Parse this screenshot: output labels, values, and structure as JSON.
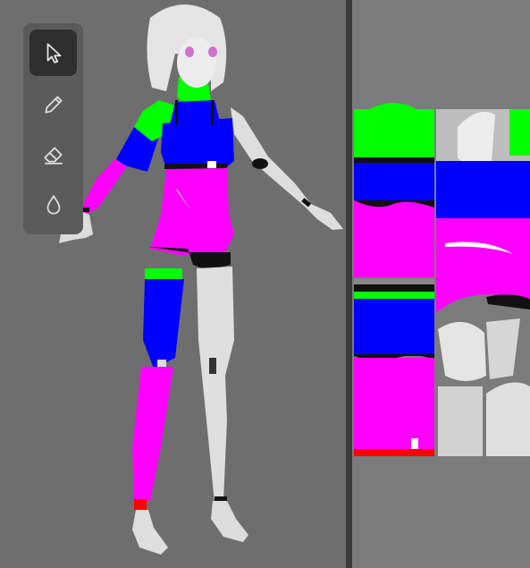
{
  "toolbar": {
    "tools": [
      {
        "name": "select",
        "icon": "cursor-arrow-icon",
        "active": true
      },
      {
        "name": "paint",
        "icon": "pencil-icon",
        "active": false
      },
      {
        "name": "erase",
        "icon": "eraser-icon",
        "active": false
      },
      {
        "name": "fill",
        "icon": "droplet-icon",
        "active": false
      }
    ]
  },
  "colors": {
    "viewport_bg": "#6e6e6e",
    "splitter": "#3c3c3c",
    "uv_bg": "#7b7b7b",
    "toolbar_bg": "#5b5b5b",
    "tool_active_bg": "#2f2f2f",
    "paint_green": "#00ff00",
    "paint_blue": "#0000ff",
    "paint_magenta": "#ff00ff",
    "paint_red": "#ff0000",
    "mesh_white": "#e0e0e0"
  }
}
